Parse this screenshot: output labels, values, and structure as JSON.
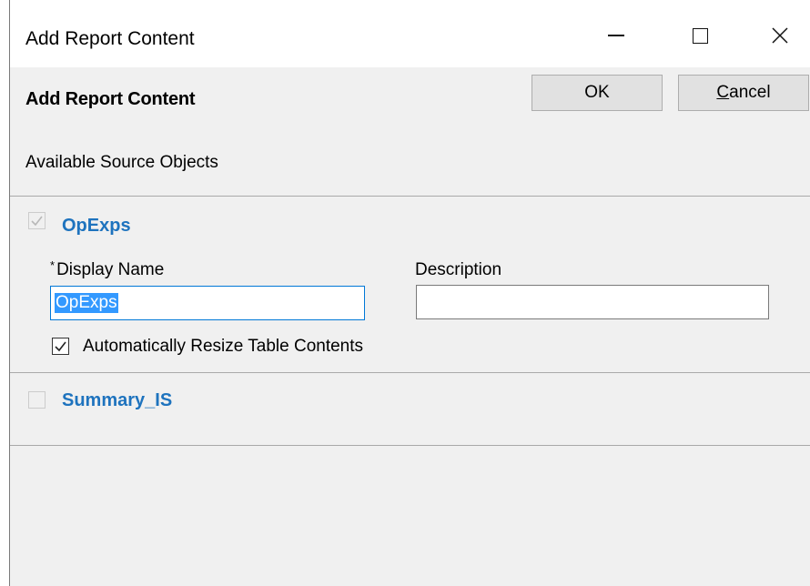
{
  "window": {
    "title": "Add Report Content",
    "controls": {
      "minimize": "minimize-icon",
      "maximize": "maximize-icon",
      "close": "close-icon"
    }
  },
  "header": {
    "title": "Add Report Content",
    "ok_label": "OK",
    "cancel_label": "Cancel",
    "cancel_mnemonic": "C",
    "cancel_rest": "ancel"
  },
  "section_label": "Available Source Objects",
  "objects": [
    {
      "name": "OpExps",
      "checked": true,
      "enabled": false,
      "display_name_label": "Display Name",
      "required_marker": "*",
      "display_name_value": "OpExps",
      "description_label": "Description",
      "description_value": "",
      "auto_resize_label": "Automatically Resize Table Contents",
      "auto_resize_checked": true
    },
    {
      "name": "Summary_IS",
      "checked": false,
      "enabled": false
    }
  ],
  "colors": {
    "object_name": "#1e73be",
    "selection": "#3399ff",
    "focus_border": "#0078d7",
    "dialog_bg": "#f0f0f0"
  }
}
